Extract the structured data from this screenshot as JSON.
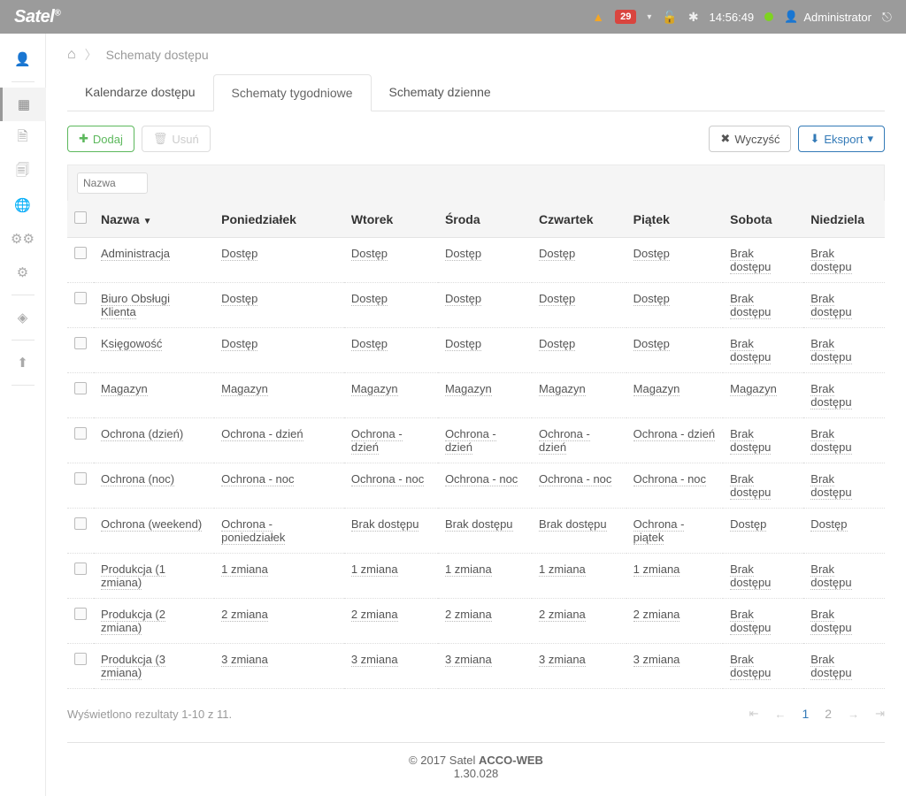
{
  "topbar": {
    "logo": "Satel",
    "badge": "29",
    "time": "14:56:49",
    "user": "Administrator"
  },
  "breadcrumb": {
    "title": "Schematy dostępu"
  },
  "tabs": [
    {
      "label": "Kalendarze dostępu"
    },
    {
      "label": "Schematy tygodniowe"
    },
    {
      "label": "Schematy dzienne"
    }
  ],
  "toolbar": {
    "add": "Dodaj",
    "del": "Usuń",
    "clear": "Wyczyść",
    "export": "Eksport"
  },
  "filter": {
    "name_placeholder": "Nazwa"
  },
  "table": {
    "headers": {
      "name": "Nazwa",
      "mon": "Poniedziałek",
      "tue": "Wtorek",
      "wed": "Środa",
      "thu": "Czwartek",
      "fri": "Piątek",
      "sat": "Sobota",
      "sun": "Niedziela"
    },
    "rows": [
      {
        "name": "Administracja",
        "mon": "Dostęp",
        "tue": "Dostęp",
        "wed": "Dostęp",
        "thu": "Dostęp",
        "fri": "Dostęp",
        "sat": "Brak dostępu",
        "sun": "Brak dostępu"
      },
      {
        "name": "Biuro Obsługi Klienta",
        "mon": "Dostęp",
        "tue": "Dostęp",
        "wed": "Dostęp",
        "thu": "Dostęp",
        "fri": "Dostęp",
        "sat": "Brak dostępu",
        "sun": "Brak dostępu"
      },
      {
        "name": "Księgowość",
        "mon": "Dostęp",
        "tue": "Dostęp",
        "wed": "Dostęp",
        "thu": "Dostęp",
        "fri": "Dostęp",
        "sat": "Brak dostępu",
        "sun": "Brak dostępu"
      },
      {
        "name": "Magazyn",
        "mon": "Magazyn",
        "tue": "Magazyn",
        "wed": "Magazyn",
        "thu": "Magazyn",
        "fri": "Magazyn",
        "sat": "Magazyn",
        "sun": "Brak dostępu"
      },
      {
        "name": "Ochrona (dzień)",
        "mon": "Ochrona - dzień",
        "tue": "Ochrona - dzień",
        "wed": "Ochrona - dzień",
        "thu": "Ochrona - dzień",
        "fri": "Ochrona - dzień",
        "sat": "Brak dostępu",
        "sun": "Brak dostępu"
      },
      {
        "name": "Ochrona (noc)",
        "mon": "Ochrona - noc",
        "tue": "Ochrona - noc",
        "wed": "Ochrona - noc",
        "thu": "Ochrona - noc",
        "fri": "Ochrona - noc",
        "sat": "Brak dostępu",
        "sun": "Brak dostępu"
      },
      {
        "name": "Ochrona (weekend)",
        "mon": "Ochrona - poniedziałek",
        "tue": "Brak dostępu",
        "wed": "Brak dostępu",
        "thu": "Brak dostępu",
        "fri": "Ochrona - piątek",
        "sat": "Dostęp",
        "sun": "Dostęp"
      },
      {
        "name": "Produkcja (1 zmiana)",
        "mon": "1 zmiana",
        "tue": "1 zmiana",
        "wed": "1 zmiana",
        "thu": "1 zmiana",
        "fri": "1 zmiana",
        "sat": "Brak dostępu",
        "sun": "Brak dostępu"
      },
      {
        "name": "Produkcja (2 zmiana)",
        "mon": "2 zmiana",
        "tue": "2 zmiana",
        "wed": "2 zmiana",
        "thu": "2 zmiana",
        "fri": "2 zmiana",
        "sat": "Brak dostępu",
        "sun": "Brak dostępu"
      },
      {
        "name": "Produkcja (3 zmiana)",
        "mon": "3 zmiana",
        "tue": "3 zmiana",
        "wed": "3 zmiana",
        "thu": "3 zmiana",
        "fri": "3 zmiana",
        "sat": "Brak dostępu",
        "sun": "Brak dostępu"
      }
    ],
    "results_text": "Wyświetlono rezultaty 1-10 z 11."
  },
  "pagination": {
    "p1": "1",
    "p2": "2"
  },
  "footer": {
    "line1a": "© 2017 Satel ",
    "line1b": "ACCO-WEB",
    "line2": "1.30.028"
  }
}
